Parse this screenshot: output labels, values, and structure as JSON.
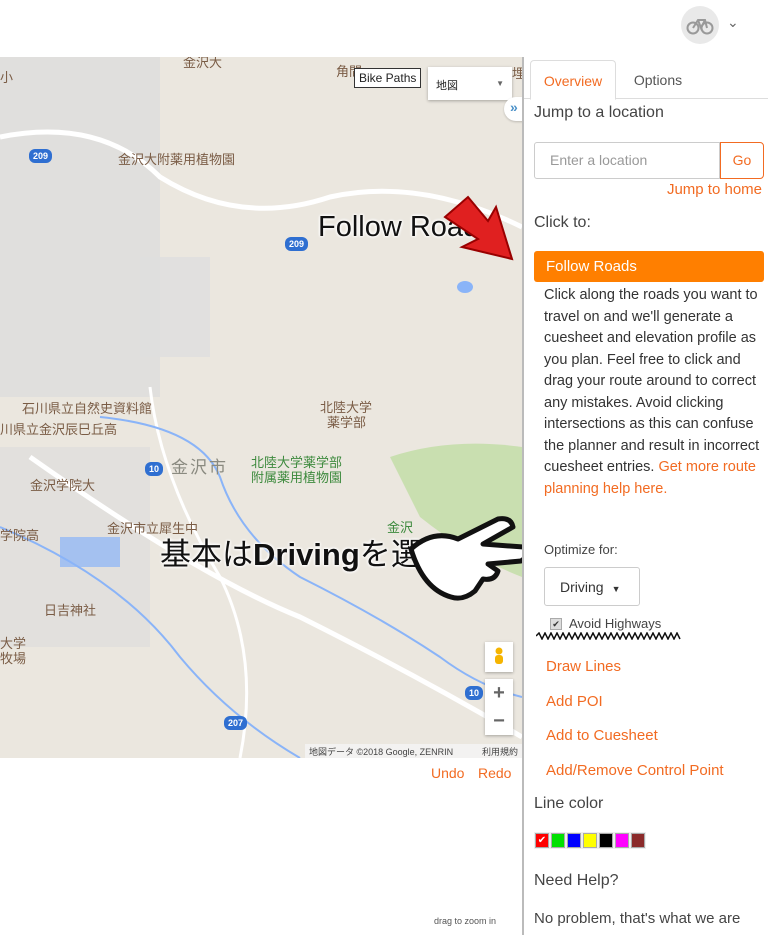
{
  "header": {
    "avatar_icon": "bicycle-icon",
    "menu_icon": "chevron-down-icon"
  },
  "map": {
    "bike_paths_label": "Bike Paths",
    "map_type": "地図",
    "attribution": "地図データ ©2018 Google, ZENRIN",
    "terms": "利用規約",
    "labels": [
      "金沢大",
      "小",
      "角間",
      "金沢大附薬用植物園",
      "石川県立自然史資料館",
      "川県立金沢辰巳丘高",
      "北陸大学",
      "薬学部",
      "金沢市",
      "北陸大学薬学部",
      "附属薬用植物園",
      "金沢学院大",
      "金沢市立犀生中",
      "学院高",
      "日吉神社",
      "大学",
      "牧場",
      "金沢",
      "埋"
    ],
    "route_shields": [
      "209",
      "209",
      "10",
      "10",
      "207"
    ],
    "zoom_in": "+",
    "zoom_out": "−",
    "annotations": {
      "follow_roads": "Follow Roads",
      "driving_prefix": "基本は",
      "driving_bold": "Driving",
      "driving_suffix": "を選択"
    }
  },
  "map_footer": {
    "undo": "Undo",
    "redo": "Redo",
    "drag_hint": "drag to zoom in"
  },
  "panel": {
    "tabs": [
      {
        "label": "Overview",
        "active": true
      },
      {
        "label": "Options",
        "active": false
      }
    ],
    "jump_title": "Jump to a location",
    "location_placeholder": "Enter a location",
    "go": "Go",
    "jump_home": "Jump to home",
    "click_to": "Click to:",
    "follow_roads": "Follow Roads",
    "description": "Click along the roads you want to travel on and we'll generate a cuesheet and elevation profile as you plan. Feel free to click and drag your route around to correct any mistakes. Avoid clicking intersections as this can confuse the planner and result in incorrect cuesheet entries. ",
    "help_link": "Get more route planning help here.",
    "optimize_label": "Optimize for:",
    "optimize_value": "Driving",
    "avoid_highways": "Avoid Highways",
    "avoid_highways_checked": true,
    "tools": [
      "Draw Lines",
      "Add POI",
      "Add to Cuesheet",
      "Add/Remove Control Point"
    ],
    "line_color_title": "Line color",
    "line_colors": [
      "#ff0000",
      "#00e000",
      "#0000ff",
      "#ffff00",
      "#000000",
      "#ff00ff",
      "#8b2a2a"
    ],
    "selected_color": "#ff0000",
    "need_help": "Need Help?",
    "help_text": "No problem, that's what we are"
  },
  "colors": {
    "accent": "#f26b22",
    "button": "#ff7f00"
  }
}
